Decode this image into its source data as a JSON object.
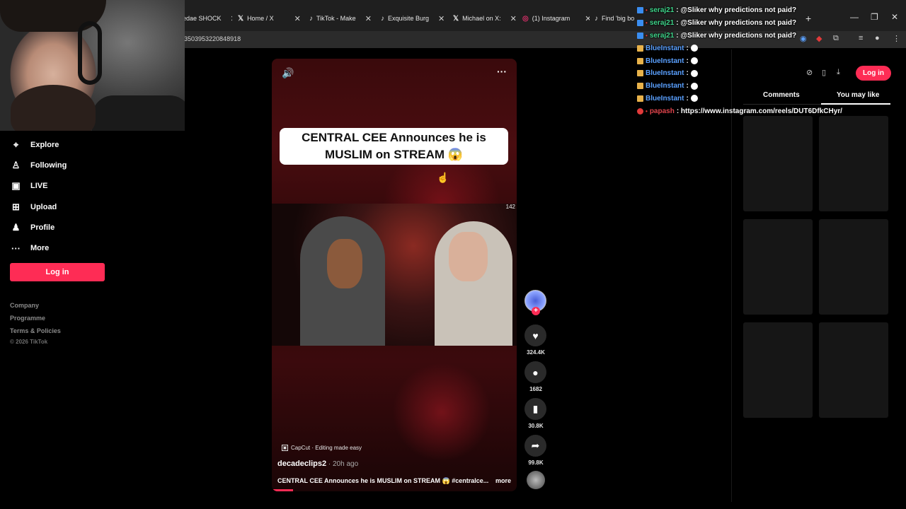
{
  "browser": {
    "tabs": [
      {
        "label": "edae SHOCK",
        "icon": "tab-icon"
      },
      {
        "label": "Home / X",
        "icon": "x-icon"
      },
      {
        "label": "TikTok - Make",
        "icon": "tiktok-icon"
      },
      {
        "label": "Exquisite Burg",
        "icon": "tiktok-icon"
      },
      {
        "label": "Michael on X:",
        "icon": "x-icon"
      },
      {
        "label": "(1) Instagram",
        "icon": "instagram-icon"
      },
      {
        "label": "Find 'big bo",
        "icon": "tiktok-icon"
      }
    ],
    "address": "3503953220848918"
  },
  "nav": {
    "items": [
      {
        "label": "Explore",
        "icon": "⌖"
      },
      {
        "label": "Following",
        "icon": "♙"
      },
      {
        "label": "LIVE",
        "icon": "▣"
      },
      {
        "label": "Upload",
        "icon": "⊞"
      },
      {
        "label": "Profile",
        "icon": "♟"
      },
      {
        "label": "More",
        "icon": "···"
      }
    ],
    "login_label": "Log in",
    "footer": [
      "Company",
      "Programme",
      "Terms & Policies"
    ],
    "copyright": "© 2026 TikTok"
  },
  "video": {
    "caption_line1": "CENTRAL CEE Announces he is",
    "caption_line2": "MUSLIM on STREAM 😱",
    "clip_number": "142",
    "capcut_label": "CapCut · Editing made easy",
    "author": "decadeclips2",
    "time": "20h ago",
    "description": "CENTRAL CEE Announces he is MUSLIM on STREAM 😱 #centralce...",
    "more_label": "more"
  },
  "actions": {
    "likes": "324.4K",
    "comments": "1682",
    "saves": "30.8K",
    "shares": "99.8K"
  },
  "right_panel": {
    "login_label": "Log in",
    "tab_comments": "Comments",
    "tab_you_may_like": "You may like"
  },
  "chat": [
    {
      "user": "seraj21",
      "msg": ": @Sliker why predictions not paid?",
      "color": "green",
      "badge": "blue"
    },
    {
      "user": "seraj21",
      "msg": ": @Sliker why predictions not paid?",
      "color": "green",
      "badge": "blue"
    },
    {
      "user": "seraj21",
      "msg": ": @Sliker why predictions not paid?",
      "color": "green",
      "badge": "blue"
    },
    {
      "user": "BlueInstant",
      "msg": ":",
      "color": "blue",
      "badge": "gold"
    },
    {
      "user": "BlueInstant",
      "msg": ":",
      "color": "blue",
      "badge": "gold"
    },
    {
      "user": "BlueInstant",
      "msg": ":",
      "color": "blue",
      "badge": "gold"
    },
    {
      "user": "BlueInstant",
      "msg": ":",
      "color": "blue",
      "badge": "gold"
    },
    {
      "user": "BlueInstant",
      "msg": ":",
      "color": "blue",
      "badge": "gold"
    },
    {
      "user": "papash",
      "msg": ": https://www.instagram.com/reels/DUT6DfkCHyr/",
      "color": "red",
      "badge": "red"
    }
  ],
  "colors": {
    "accent": "#fe2c55",
    "panel": "#161616"
  }
}
